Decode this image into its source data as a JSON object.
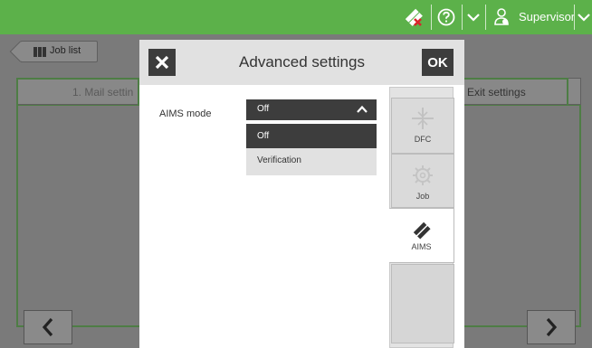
{
  "topbar": {
    "user_name": "Supervisor",
    "icons": [
      "aims-error-icon",
      "help-icon",
      "chevron-down-icon",
      "user-icon",
      "chevron-down-icon"
    ]
  },
  "background": {
    "job_list_label": "Job list",
    "tab_left_label": "1. Mail settin",
    "tab_right_label": "Exit settings"
  },
  "dialog": {
    "title": "Advanced settings",
    "ok_label": "OK",
    "field_label": "AIMS mode",
    "selected_value": "Off",
    "options": [
      "Off",
      "Verification"
    ],
    "side_tabs": [
      {
        "label": "DFC",
        "icon": "dfc-icon"
      },
      {
        "label": "Job",
        "icon": "gear-icon"
      },
      {
        "label": "AIMS",
        "icon": "aims-icon"
      }
    ]
  },
  "colors": {
    "topbar_green": "#5cb14a",
    "dark_button": "#3d3d3d",
    "dialog_header": "#e1e1e1"
  }
}
